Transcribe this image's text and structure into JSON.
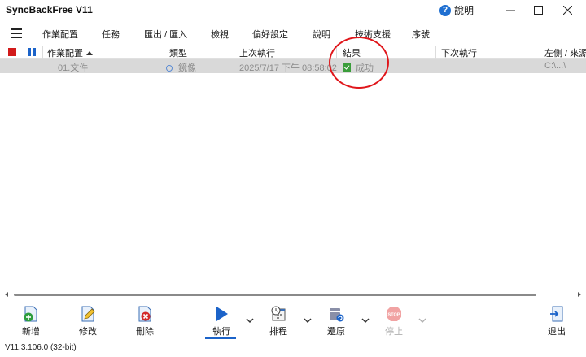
{
  "window": {
    "title": "SyncBackFree V11",
    "help_label": "說明"
  },
  "menu": {
    "items": [
      "作業配置",
      "任務",
      "匯出 / 匯入",
      "檢視",
      "偏好設定",
      "說明",
      "技術支援",
      "序號"
    ]
  },
  "grid": {
    "columns": [
      "作業配置",
      "類型",
      "上次執行",
      "結果",
      "下次執行",
      "左側 / 來源"
    ],
    "sort_column": "作業配置",
    "rows": [
      {
        "profile": "01.文件",
        "type": "鏡像",
        "last_run": "2025/7/17 下午 08:58:02",
        "result": "成功",
        "next_run": "",
        "left_source": "C:\\...\\"
      }
    ]
  },
  "toolbar": {
    "new_label": "新增",
    "edit_label": "修改",
    "delete_label": "刪除",
    "run_label": "執行",
    "schedule_label": "排程",
    "restore_label": "還原",
    "stop_label": "停止",
    "exit_label": "退出"
  },
  "status": {
    "version": "V11.3.106.0 (32-bit)"
  },
  "colors": {
    "accent": "#1b63c9",
    "stop_red": "#d21a1a",
    "success_green": "#3a9d3a",
    "annotation_red": "#e0161b"
  }
}
